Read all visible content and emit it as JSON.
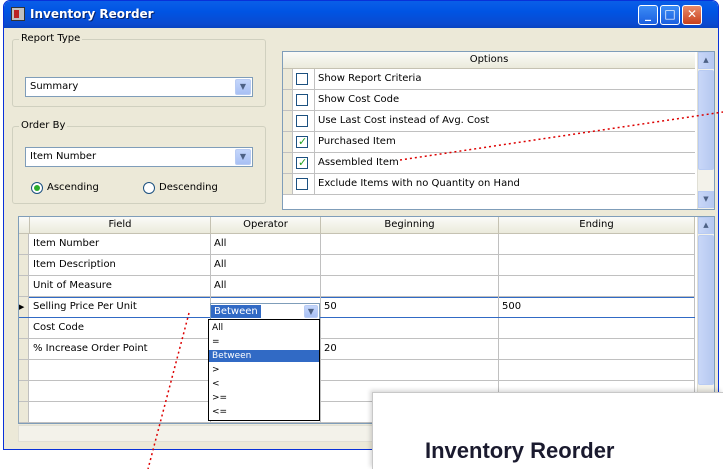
{
  "window": {
    "title": "Inventory Reorder",
    "controls": {
      "minimize": "_",
      "maximize": "□",
      "close": "✕"
    }
  },
  "report_type": {
    "label": "Report Type",
    "value": "Summary"
  },
  "order_by": {
    "label": "Order By",
    "value": "Item Number",
    "radios": [
      {
        "label": "Ascending",
        "checked": true
      },
      {
        "label": "Descending",
        "checked": false
      }
    ]
  },
  "options": {
    "header": "Options",
    "items": [
      {
        "label": "Show Report Criteria",
        "checked": false
      },
      {
        "label": "Show Cost Code",
        "checked": false
      },
      {
        "label": "Use Last Cost instead of Avg. Cost",
        "checked": false
      },
      {
        "label": "Purchased Item",
        "checked": true
      },
      {
        "label": "Assembled Item",
        "checked": true
      },
      {
        "label": "Exclude Items with no Quantity on Hand",
        "checked": false
      }
    ]
  },
  "criteria": {
    "headers": {
      "field": "Field",
      "operator": "Operator",
      "beginning": "Beginning",
      "ending": "Ending"
    },
    "rows": [
      {
        "field": "Item Number",
        "operator": "All",
        "beginning": "",
        "ending": ""
      },
      {
        "field": "Item Description",
        "operator": "All",
        "beginning": "",
        "ending": ""
      },
      {
        "field": "Unit of Measure",
        "operator": "All",
        "beginning": "",
        "ending": ""
      },
      {
        "field": "Selling Price Per Unit",
        "operator": "Between",
        "beginning": "50",
        "ending": "500"
      },
      {
        "field": "Cost Code",
        "operator": "",
        "beginning": "",
        "ending": ""
      },
      {
        "field": "% Increase Order Point",
        "operator": "",
        "beginning": "20",
        "ending": ""
      }
    ],
    "operator_options": [
      "All",
      "=",
      "Between",
      ">",
      "<",
      ">=",
      "<="
    ],
    "operator_selected": "Between"
  },
  "callout": {
    "title": "Inventory Reorder"
  },
  "colors": {
    "titlebar": "#0054e3",
    "selection": "#316ac5",
    "annotation_line": "#dd0000"
  }
}
